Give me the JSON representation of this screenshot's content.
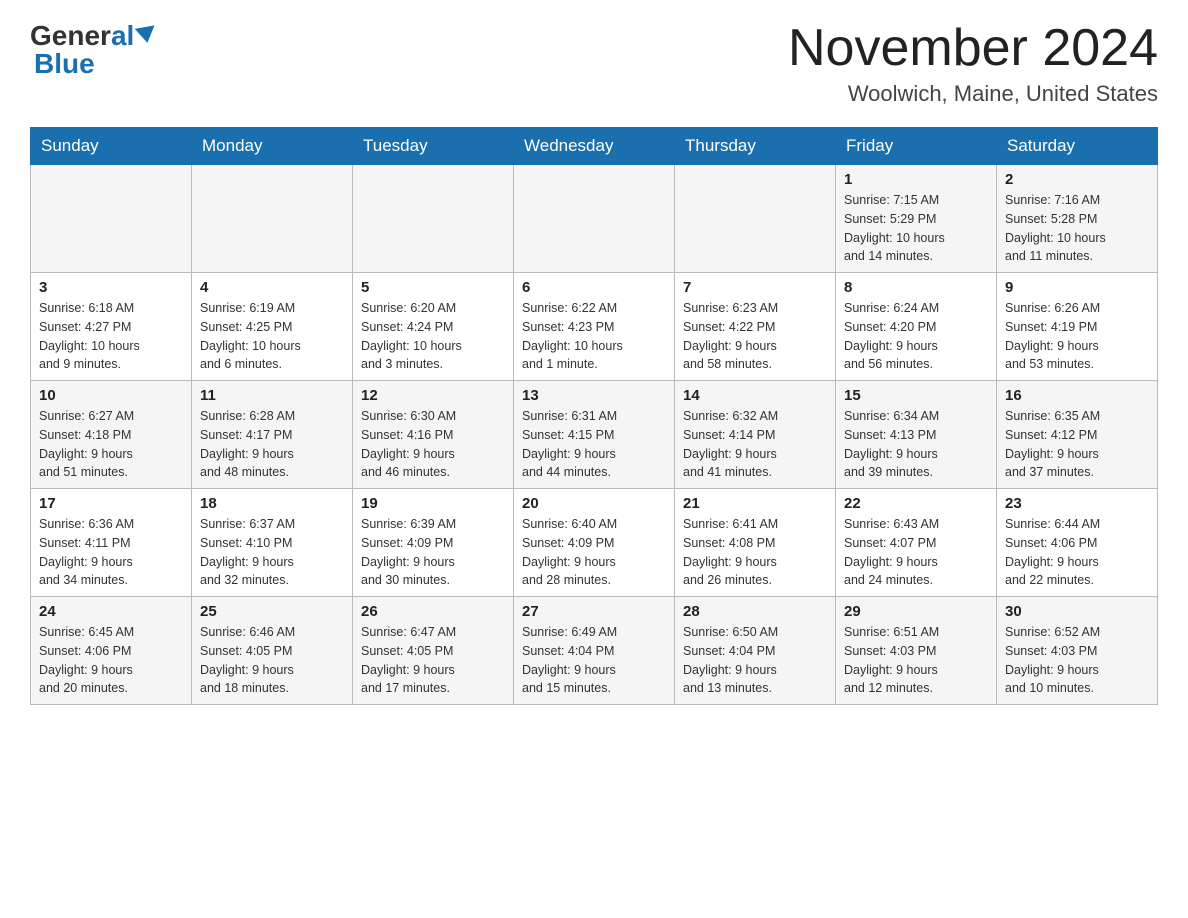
{
  "header": {
    "logo_general": "General",
    "logo_blue": "Blue",
    "month_title": "November 2024",
    "location": "Woolwich, Maine, United States"
  },
  "weekdays": [
    "Sunday",
    "Monday",
    "Tuesday",
    "Wednesday",
    "Thursday",
    "Friday",
    "Saturday"
  ],
  "weeks": [
    [
      {
        "day": "",
        "info": ""
      },
      {
        "day": "",
        "info": ""
      },
      {
        "day": "",
        "info": ""
      },
      {
        "day": "",
        "info": ""
      },
      {
        "day": "",
        "info": ""
      },
      {
        "day": "1",
        "info": "Sunrise: 7:15 AM\nSunset: 5:29 PM\nDaylight: 10 hours\nand 14 minutes."
      },
      {
        "day": "2",
        "info": "Sunrise: 7:16 AM\nSunset: 5:28 PM\nDaylight: 10 hours\nand 11 minutes."
      }
    ],
    [
      {
        "day": "3",
        "info": "Sunrise: 6:18 AM\nSunset: 4:27 PM\nDaylight: 10 hours\nand 9 minutes."
      },
      {
        "day": "4",
        "info": "Sunrise: 6:19 AM\nSunset: 4:25 PM\nDaylight: 10 hours\nand 6 minutes."
      },
      {
        "day": "5",
        "info": "Sunrise: 6:20 AM\nSunset: 4:24 PM\nDaylight: 10 hours\nand 3 minutes."
      },
      {
        "day": "6",
        "info": "Sunrise: 6:22 AM\nSunset: 4:23 PM\nDaylight: 10 hours\nand 1 minute."
      },
      {
        "day": "7",
        "info": "Sunrise: 6:23 AM\nSunset: 4:22 PM\nDaylight: 9 hours\nand 58 minutes."
      },
      {
        "day": "8",
        "info": "Sunrise: 6:24 AM\nSunset: 4:20 PM\nDaylight: 9 hours\nand 56 minutes."
      },
      {
        "day": "9",
        "info": "Sunrise: 6:26 AM\nSunset: 4:19 PM\nDaylight: 9 hours\nand 53 minutes."
      }
    ],
    [
      {
        "day": "10",
        "info": "Sunrise: 6:27 AM\nSunset: 4:18 PM\nDaylight: 9 hours\nand 51 minutes."
      },
      {
        "day": "11",
        "info": "Sunrise: 6:28 AM\nSunset: 4:17 PM\nDaylight: 9 hours\nand 48 minutes."
      },
      {
        "day": "12",
        "info": "Sunrise: 6:30 AM\nSunset: 4:16 PM\nDaylight: 9 hours\nand 46 minutes."
      },
      {
        "day": "13",
        "info": "Sunrise: 6:31 AM\nSunset: 4:15 PM\nDaylight: 9 hours\nand 44 minutes."
      },
      {
        "day": "14",
        "info": "Sunrise: 6:32 AM\nSunset: 4:14 PM\nDaylight: 9 hours\nand 41 minutes."
      },
      {
        "day": "15",
        "info": "Sunrise: 6:34 AM\nSunset: 4:13 PM\nDaylight: 9 hours\nand 39 minutes."
      },
      {
        "day": "16",
        "info": "Sunrise: 6:35 AM\nSunset: 4:12 PM\nDaylight: 9 hours\nand 37 minutes."
      }
    ],
    [
      {
        "day": "17",
        "info": "Sunrise: 6:36 AM\nSunset: 4:11 PM\nDaylight: 9 hours\nand 34 minutes."
      },
      {
        "day": "18",
        "info": "Sunrise: 6:37 AM\nSunset: 4:10 PM\nDaylight: 9 hours\nand 32 minutes."
      },
      {
        "day": "19",
        "info": "Sunrise: 6:39 AM\nSunset: 4:09 PM\nDaylight: 9 hours\nand 30 minutes."
      },
      {
        "day": "20",
        "info": "Sunrise: 6:40 AM\nSunset: 4:09 PM\nDaylight: 9 hours\nand 28 minutes."
      },
      {
        "day": "21",
        "info": "Sunrise: 6:41 AM\nSunset: 4:08 PM\nDaylight: 9 hours\nand 26 minutes."
      },
      {
        "day": "22",
        "info": "Sunrise: 6:43 AM\nSunset: 4:07 PM\nDaylight: 9 hours\nand 24 minutes."
      },
      {
        "day": "23",
        "info": "Sunrise: 6:44 AM\nSunset: 4:06 PM\nDaylight: 9 hours\nand 22 minutes."
      }
    ],
    [
      {
        "day": "24",
        "info": "Sunrise: 6:45 AM\nSunset: 4:06 PM\nDaylight: 9 hours\nand 20 minutes."
      },
      {
        "day": "25",
        "info": "Sunrise: 6:46 AM\nSunset: 4:05 PM\nDaylight: 9 hours\nand 18 minutes."
      },
      {
        "day": "26",
        "info": "Sunrise: 6:47 AM\nSunset: 4:05 PM\nDaylight: 9 hours\nand 17 minutes."
      },
      {
        "day": "27",
        "info": "Sunrise: 6:49 AM\nSunset: 4:04 PM\nDaylight: 9 hours\nand 15 minutes."
      },
      {
        "day": "28",
        "info": "Sunrise: 6:50 AM\nSunset: 4:04 PM\nDaylight: 9 hours\nand 13 minutes."
      },
      {
        "day": "29",
        "info": "Sunrise: 6:51 AM\nSunset: 4:03 PM\nDaylight: 9 hours\nand 12 minutes."
      },
      {
        "day": "30",
        "info": "Sunrise: 6:52 AM\nSunset: 4:03 PM\nDaylight: 9 hours\nand 10 minutes."
      }
    ]
  ]
}
